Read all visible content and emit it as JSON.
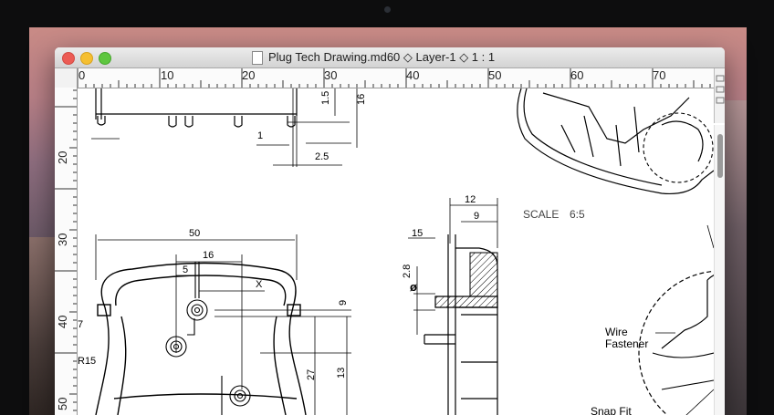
{
  "window": {
    "title": "Plug Tech Drawing.md60 ◇ Layer-1 ◇ 1 : 1"
  },
  "rulers": {
    "horizontal": [
      "0",
      "10",
      "20",
      "30",
      "40",
      "50",
      "60",
      "70"
    ],
    "vertical": [
      "20",
      "30",
      "40",
      "50"
    ]
  },
  "drawing": {
    "dims": [
      "1.5",
      "16",
      "1",
      "2.5",
      "50",
      "16",
      "5",
      "X",
      "12",
      "9",
      "15",
      "2.8",
      "9",
      "27",
      "13",
      "7",
      "R15"
    ],
    "diameter_symbol": "ø",
    "scale_label": "SCALE",
    "scale_value": "6:5",
    "callouts": {
      "wire_line1": "Wire",
      "wire_line2": "Fastener",
      "snap": "Snap Fit"
    }
  },
  "icons": {
    "close": "close-icon",
    "minimize": "minimize-icon",
    "maximize": "maximize-icon",
    "document": "document-icon"
  },
  "colors": {
    "close": "#ec5b54",
    "minimize": "#f5bf31",
    "maximize": "#5ec63f"
  }
}
